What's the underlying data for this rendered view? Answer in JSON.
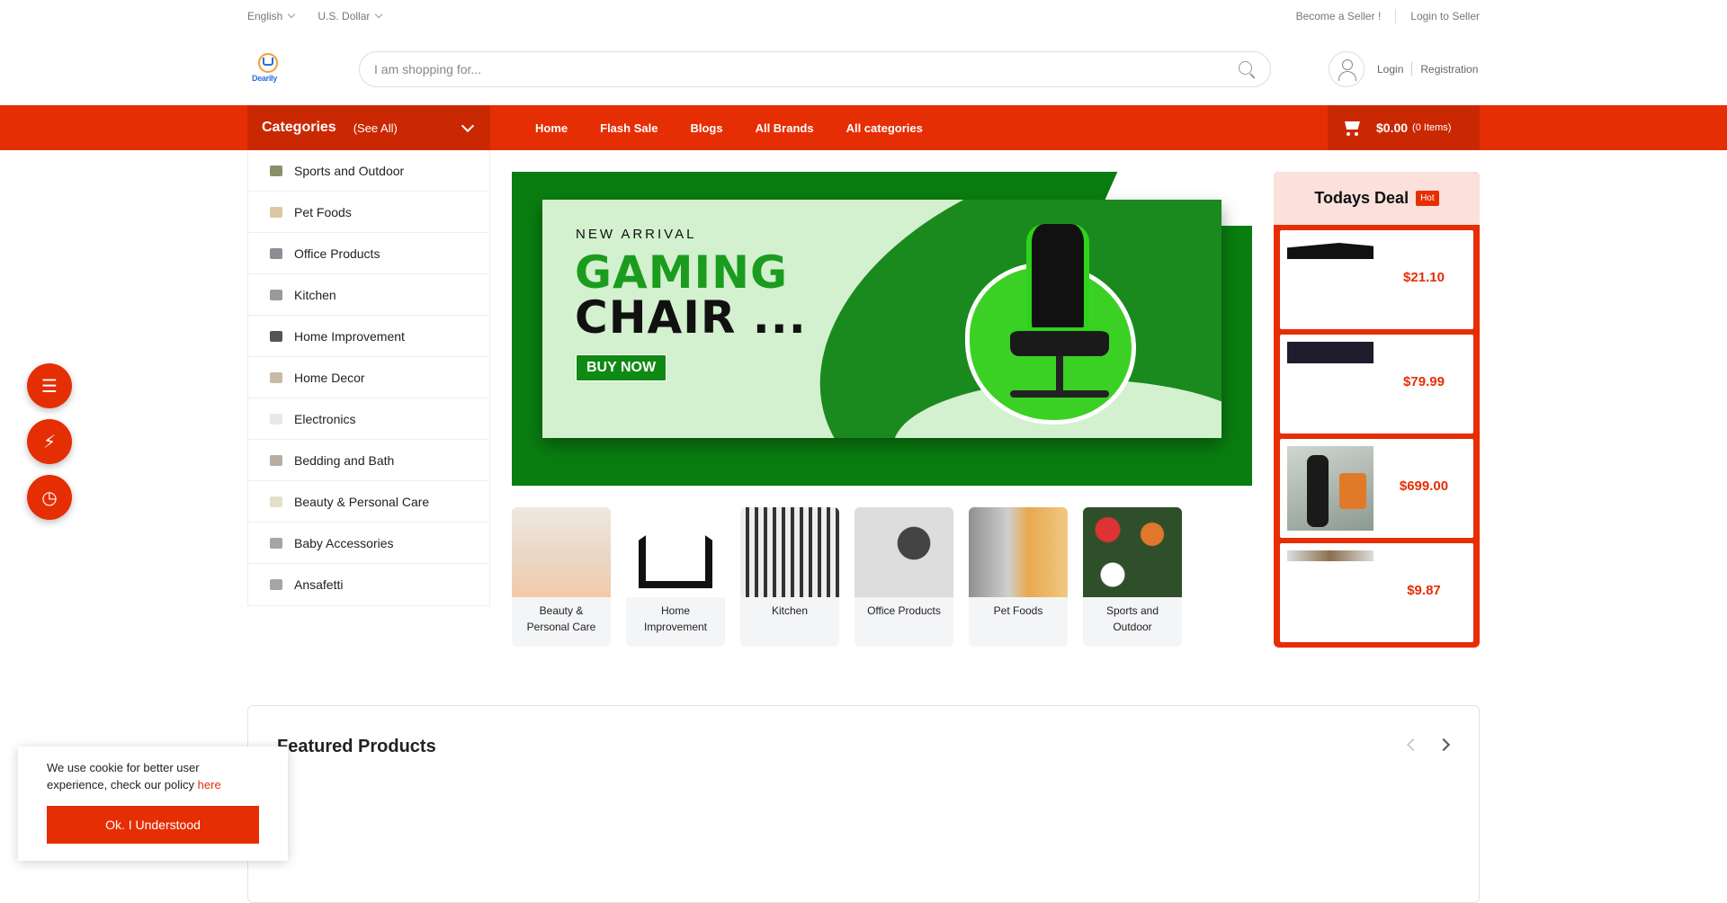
{
  "topbar": {
    "language": "English",
    "currency": "U.S. Dollar",
    "become_seller": "Become a Seller !",
    "login_seller": "Login to Seller"
  },
  "header": {
    "logo_text": "Dearily",
    "search_placeholder": "I am shopping for...",
    "login": "Login",
    "registration": "Registration"
  },
  "nav": {
    "categories_title": "Categories",
    "see_all": "(See All)",
    "menu": [
      "Home",
      "Flash Sale",
      "Blogs",
      "All Brands",
      "All categories"
    ],
    "cart_amount": "$0.00",
    "cart_count": "(0 Items)"
  },
  "categories": [
    "Sports and Outdoor",
    "Pet Foods",
    "Office Products",
    "Kitchen",
    "Home Improvement",
    "Home Decor",
    "Electronics",
    "Bedding and Bath",
    "Beauty & Personal Care",
    "Baby Accessories",
    "Ansafetti"
  ],
  "banner": {
    "subtitle": "NEW ARRIVAL",
    "line1": "GAMING",
    "line2": "CHAIR ...",
    "button": "BUY NOW"
  },
  "tiles": [
    "Beauty & Personal Care",
    "Home Improvement",
    "Kitchen",
    "Office Products",
    "Pet Foods",
    "Sports and Outdoor"
  ],
  "deal": {
    "title": "Todays Deal",
    "badge": "Hot",
    "prices": [
      "$21.10",
      "$79.99",
      "$699.00",
      "$9.87"
    ]
  },
  "featured": {
    "title": "Featured Products"
  },
  "cookie": {
    "text": "We use cookie for better user experience, check our policy",
    "link": "here",
    "button": "Ok. I Understood"
  },
  "colors": {
    "accent": "#e62e04",
    "deal_header": "#fbe0dc",
    "banner_green": "#0a7d10"
  }
}
